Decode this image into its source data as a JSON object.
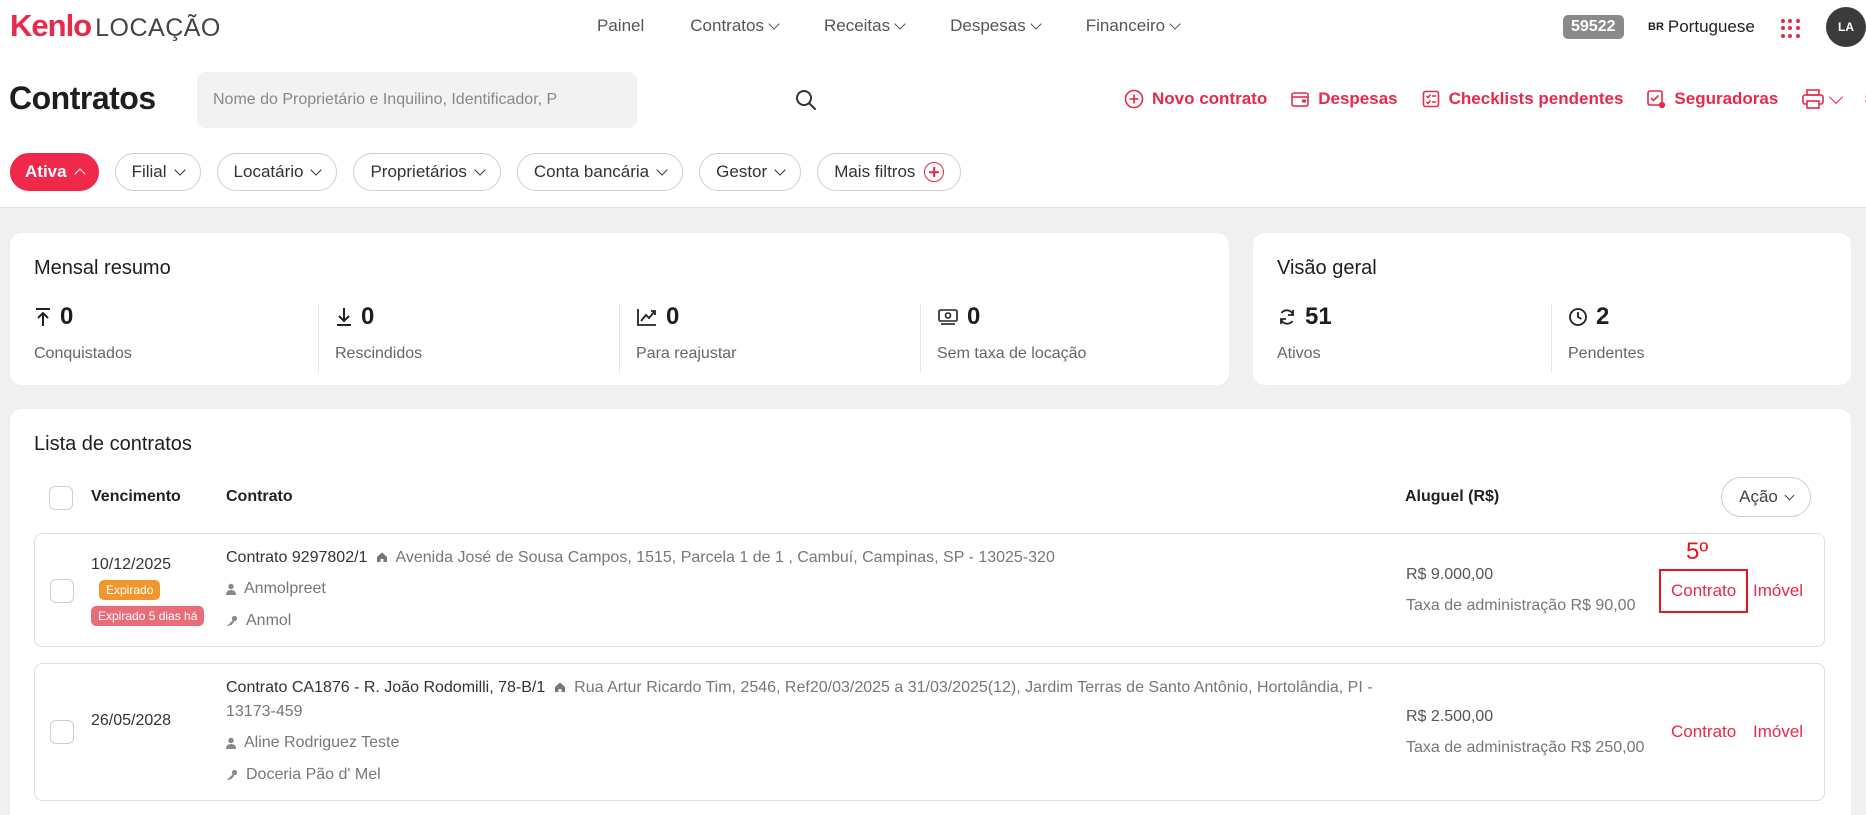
{
  "brand": {
    "logo_main": "Kenlo",
    "logo_sub": "LOCAÇÃO"
  },
  "nav": [
    {
      "label": "Painel",
      "dropdown": false
    },
    {
      "label": "Contratos",
      "dropdown": true
    },
    {
      "label": "Receitas",
      "dropdown": true
    },
    {
      "label": "Despesas",
      "dropdown": true
    },
    {
      "label": "Financeiro",
      "dropdown": true
    }
  ],
  "header": {
    "badge": "59522",
    "lang_code": "BR",
    "lang_label": "Portuguese",
    "avatar": "LA"
  },
  "page": {
    "title": "Contratos",
    "search_placeholder": "Nome do Proprietário e Inquilino, Identificador, P"
  },
  "actions": [
    {
      "label": "Novo contrato",
      "icon": "plus-circle-icon"
    },
    {
      "label": "Despesas",
      "icon": "wallet-icon"
    },
    {
      "label": "Checklists pendentes",
      "icon": "checklist-icon"
    },
    {
      "label": "Seguradoras",
      "icon": "insurance-icon"
    }
  ],
  "filters": {
    "active": "Ativa",
    "items": [
      "Filial",
      "Locatário",
      "Proprietários",
      "Conta bancária",
      "Gestor"
    ],
    "more": "Mais filtros"
  },
  "summary": {
    "title": "Mensal resumo",
    "stats": [
      {
        "value": "0",
        "label": "Conquistados",
        "icon": "arrow-up-icon"
      },
      {
        "value": "0",
        "label": "Rescindidos",
        "icon": "arrow-down-icon"
      },
      {
        "value": "0",
        "label": "Para reajustar",
        "icon": "trend-up-icon"
      },
      {
        "value": "0",
        "label": "Sem taxa de locação",
        "icon": "money-icon"
      }
    ]
  },
  "overview": {
    "title": "Visão geral",
    "stats": [
      {
        "value": "51",
        "label": "Ativos",
        "icon": "refresh-icon"
      },
      {
        "value": "2",
        "label": "Pendentes",
        "icon": "clock-icon"
      }
    ]
  },
  "list": {
    "title": "Lista de contratos",
    "columns": {
      "due": "Vencimento",
      "contract": "Contrato",
      "rent": "Aluguel (R$)"
    },
    "action_button": "Ação",
    "rows": [
      {
        "due": "10/12/2025",
        "tags": [
          "Expirado",
          "Expirado 5 dias há"
        ],
        "contract": "Contrato 9297802/1",
        "address": "Avenida José de Sousa Campos, 1515, Parcela 1 de 1 , Cambuí, Campinas, SP - 13025-320",
        "owner": "Anmolpreet",
        "tenant": "Anmol",
        "rent": "R$ 9.000,00",
        "fee": "Taxa de administração R$ 90,00",
        "link_contract": "Contrato",
        "link_property": "Imóvel"
      },
      {
        "due": "26/05/2028",
        "tags": [],
        "contract": "Contrato CA1876 - R. João Rodomilli, 78-B/1",
        "address": "Rua Artur Ricardo Tim, 2546, Ref20/03/2025 a 31/03/2025(12), Jardim Terras de Santo Antônio, Hortolândia, PI - 13173-459",
        "owner": "Aline Rodriguez Teste",
        "tenant": "Doceria Pão d' Mel",
        "rent": "R$ 2.500,00",
        "fee": "Taxa de administração R$ 250,00",
        "link_contract": "Contrato",
        "link_property": "Imóvel"
      }
    ]
  },
  "annotation": {
    "label": "5º",
    "color": "#e8141e"
  },
  "colors": {
    "accent": "#e8294a",
    "badge_gray": "#8a8a8a",
    "tag_orange": "#f0962f",
    "tag_red": "#e96d78"
  }
}
